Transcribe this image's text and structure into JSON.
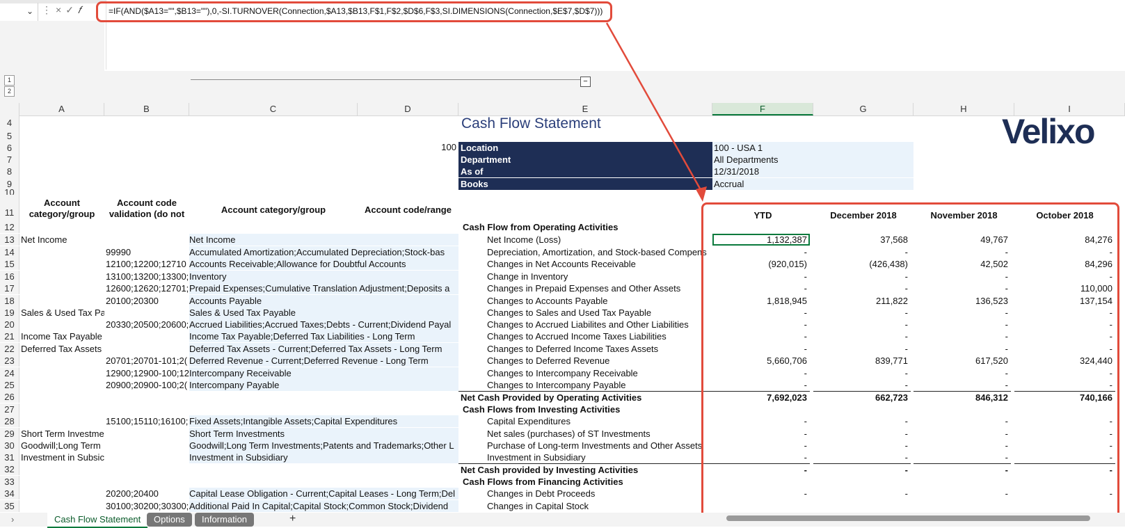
{
  "formula_bar": {
    "name_box": "",
    "formula": "=IF(AND($A13=\"\",$B13=\"\"),0,-SI.TURNOVER(Connection,$A13,$B13,F$1,F$2,$D$6,F$3,SI.DIMENSIONS(Connection,$E$7,$D$7)))",
    "controls": "× ✓ 𝑓"
  },
  "outline_levels": [
    "1",
    "2"
  ],
  "columns": [
    "A",
    "B",
    "C",
    "D",
    "E",
    "F",
    "G",
    "H",
    "I"
  ],
  "rows": [
    "4",
    "5",
    "6",
    "7",
    "8",
    "9",
    "10",
    "11",
    "12",
    "13",
    "14",
    "15",
    "16",
    "17",
    "18",
    "19",
    "20",
    "21",
    "22",
    "23",
    "24",
    "25",
    "26",
    "27",
    "28",
    "29",
    "30",
    "31",
    "32",
    "33",
    "34",
    "35"
  ],
  "report": {
    "title": "Cash Flow Statement",
    "logo": "Velixo",
    "d6_value": "100",
    "params": [
      {
        "label": "Location",
        "value": "100 - USA 1"
      },
      {
        "label": "Department",
        "value": "All Departments"
      },
      {
        "label": "As of",
        "value": "12/31/2018"
      },
      {
        "label": "Books",
        "value": "Accrual"
      }
    ]
  },
  "headers": {
    "a": "Account category/group",
    "b": "Account code validation (do not",
    "c": "Account category/group",
    "d": "Account code/range",
    "f": "YTD",
    "g": "December 2018",
    "h": "November 2018",
    "i": "October 2018"
  },
  "table": [
    {
      "a": "",
      "b": "",
      "c": "",
      "e": "Cash Flow from Operating Activities",
      "e_bold": true,
      "f": "",
      "g": "",
      "h": "",
      "i": ""
    },
    {
      "a": "Net Income",
      "b": "",
      "c": "Net Income",
      "e": "Net Income (Loss)",
      "f": "1,132,387",
      "g": "37,568",
      "h": "49,767",
      "i": "84,276"
    },
    {
      "a": "",
      "b": "99990",
      "c": "Accumulated Amortization;Accumulated Depreciation;Stock-bas",
      "e": "Depreciation, Amortization, and Stock-based Compens",
      "f": "-",
      "g": "-",
      "h": "-",
      "i": "-"
    },
    {
      "a": "",
      "b": "12100;12200;12710",
      "c": "Accounts Receivable;Allowance for Doubtful Accounts",
      "e": "Changes in Net Accounts Receivable",
      "f": "(920,015)",
      "g": "(426,438)",
      "h": "42,502",
      "i": "84,296"
    },
    {
      "a": "",
      "b": "13100;13200;13300;",
      "c": "Inventory",
      "e": "Change in Inventory",
      "f": "-",
      "g": "-",
      "h": "-",
      "i": "-"
    },
    {
      "a": "",
      "b": "12600;12620;12701;",
      "c": "Prepaid Expenses;Cumulative Translation Adjustment;Deposits a",
      "e": "Changes in Prepaid Expenses and Other Assets",
      "f": "-",
      "g": "-",
      "h": "-",
      "i": "110,000"
    },
    {
      "a": "",
      "b": "20100;20300",
      "c": "Accounts Payable",
      "e": "Changes to Accounts Payable",
      "f": "1,818,945",
      "g": "211,822",
      "h": "136,523",
      "i": "137,154"
    },
    {
      "a": "Sales & Used Tax Pa",
      "b": "",
      "c": "Sales & Used Tax Payable",
      "e": "Changes to Sales and Used Tax Payable",
      "f": "-",
      "g": "-",
      "h": "-",
      "i": "-"
    },
    {
      "a": "",
      "b": "20330;20500;20600;",
      "c": "Accrued Liabilities;Accrued Taxes;Debts - Current;Dividend Payal",
      "e": "Changes to Accrued Liabilites and Other Liabilities",
      "f": "-",
      "g": "-",
      "h": "-",
      "i": "-"
    },
    {
      "a": "Income Tax Payable",
      "b": "",
      "c": "Income Tax Payable;Deferred Tax Liabilities - Long Term",
      "e": "Changes to Accrued Income Taxes Liabilities",
      "f": "-",
      "g": "-",
      "h": "-",
      "i": "-"
    },
    {
      "a": "Deferred Tax Assets",
      "b": "",
      "c": "Deferred Tax Assets - Current;Deferred Tax Assets - Long Term",
      "e": "Changes to Deferred Income Taxes Assets",
      "f": "-",
      "g": "-",
      "h": "-",
      "i": "-"
    },
    {
      "a": "",
      "b": "20701;20701-101;2(",
      "c": "Deferred Revenue - Current;Deferred Revenue - Long Term",
      "e": "Changes to Deferred Revenue",
      "f": "5,660,706",
      "g": "839,771",
      "h": "617,520",
      "i": "324,440"
    },
    {
      "a": "",
      "b": "12900;12900-100;12",
      "c": "Intercompany Receivable",
      "e": "Changes to Intercompany Receivable",
      "f": "-",
      "g": "-",
      "h": "-",
      "i": "-"
    },
    {
      "a": "",
      "b": "20900;20900-100;2(",
      "c": "Intercompany Payable",
      "e": "Changes to Intercompany Payable",
      "f": "-",
      "g": "-",
      "h": "-",
      "i": "-"
    },
    {
      "a": "",
      "b": "",
      "c": "",
      "e": "Net Cash Provided by Operating Activities",
      "e_bold": true,
      "total": true,
      "f": "7,692,023",
      "g": "662,723",
      "h": "846,312",
      "i": "740,166"
    },
    {
      "a": "",
      "b": "",
      "c": "",
      "e": "Cash Flows from Investing Activities",
      "e_bold": true,
      "f": "",
      "g": "",
      "h": "",
      "i": ""
    },
    {
      "a": "",
      "b": "15100;15110;16100;",
      "c": "Fixed Assets;Intangible Assets;Capital Expenditures",
      "e": "Capital Expenditures",
      "f": "-",
      "g": "-",
      "h": "-",
      "i": "-"
    },
    {
      "a": "Short Term Investme",
      "b": "",
      "c": "Short Term Investments",
      "e": "Net sales (purchases) of ST Investments",
      "f": "-",
      "g": "-",
      "h": "-",
      "i": "-"
    },
    {
      "a": "Goodwill;Long Term",
      "b": "",
      "c": "Goodwill;Long Term Investments;Patents and Trademarks;Other L",
      "e": "Purchase of Long-term Investments and Other Assets",
      "f": "-",
      "g": "-",
      "h": "-",
      "i": "-"
    },
    {
      "a": "Investment in Subsic",
      "b": "",
      "c": "Investment in Subsidiary",
      "e": "Investment in Subsidiary",
      "f": "-",
      "g": "-",
      "h": "-",
      "i": "-"
    },
    {
      "a": "",
      "b": "",
      "c": "",
      "e": "Net Cash provided by Investing Activities",
      "e_bold": true,
      "total": true,
      "f": "-",
      "g": "-",
      "h": "-",
      "i": "-"
    },
    {
      "a": "",
      "b": "",
      "c": "",
      "e": "Cash Flows from Financing Activities",
      "e_bold": true,
      "f": "",
      "g": "",
      "h": "",
      "i": ""
    },
    {
      "a": "",
      "b": "20200;20400",
      "c": "Capital Lease Obligation - Current;Capital Leases - Long Term;Del",
      "e": "Changes in Debt Proceeds",
      "f": "-",
      "g": "-",
      "h": "-",
      "i": "-"
    },
    {
      "a": "",
      "b": "30100;30200;30300;",
      "c": "Additional Paid In Capital;Capital Stock;Common Stock;Dividend",
      "e": "Changes in Capital Stock",
      "f": "",
      "g": "",
      "h": "",
      "i": ""
    }
  ],
  "sheet_tabs": [
    "Cash Flow Statement",
    "Options",
    "Information"
  ],
  "add_tab": "+",
  "colors": {
    "accent": "#0a7a3c",
    "navy": "#1e2e55",
    "callout": "#e24b3b",
    "input_fill": "#eaf3fb"
  }
}
